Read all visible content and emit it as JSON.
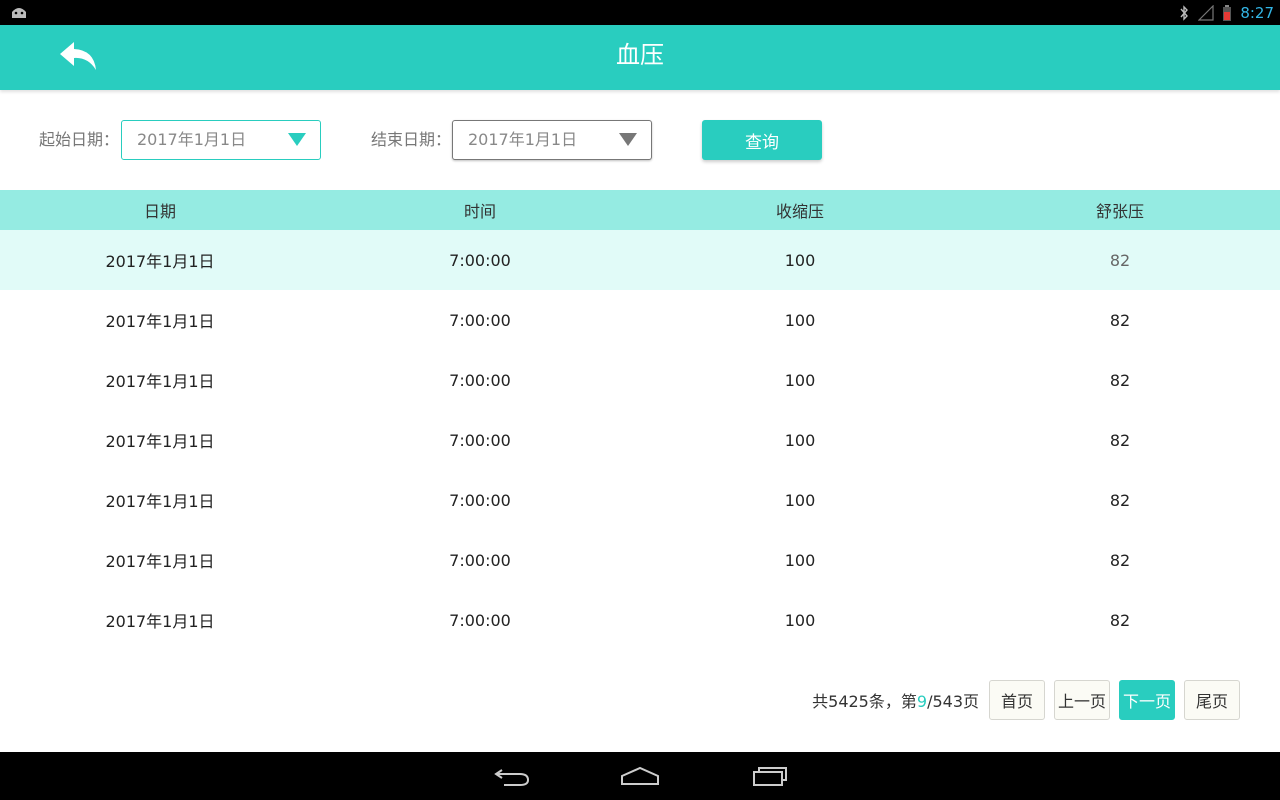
{
  "status_bar": {
    "time": "8:27"
  },
  "app_bar": {
    "title": "血压"
  },
  "filters": {
    "start_label": "起始日期：",
    "start_value": "2017年1月1日",
    "end_label": "结束日期：",
    "end_value": "2017年1月1日",
    "query_label": "查询"
  },
  "table": {
    "headers": [
      "日期",
      "时间",
      "收缩压",
      "舒张压"
    ],
    "rows": [
      [
        "2017年1月1日",
        "7:00:00",
        "100",
        "82"
      ],
      [
        "2017年1月1日",
        "7:00:00",
        "100",
        "82"
      ],
      [
        "2017年1月1日",
        "7:00:00",
        "100",
        "82"
      ],
      [
        "2017年1月1日",
        "7:00:00",
        "100",
        "82"
      ],
      [
        "2017年1月1日",
        "7:00:00",
        "100",
        "82"
      ],
      [
        "2017年1月1日",
        "7:00:00",
        "100",
        "82"
      ],
      [
        "2017年1月1日",
        "7:00:00",
        "100",
        "82"
      ]
    ]
  },
  "pagination": {
    "summary_prefix": "共5425条，第",
    "current_page": "9",
    "summary_suffix": "/543页",
    "first": "首页",
    "prev": "上一页",
    "next": "下一页",
    "last": "尾页"
  },
  "colors": {
    "accent": "#29cdbf",
    "header_row": "#95ebe2",
    "highlight_row": "#e1fbf8"
  },
  "icons": {
    "back": "back-arrow-icon",
    "dropdown": "triangle-down-icon",
    "nav_back": "nav-back-icon",
    "nav_home": "nav-home-icon",
    "nav_recents": "nav-recents-icon"
  }
}
